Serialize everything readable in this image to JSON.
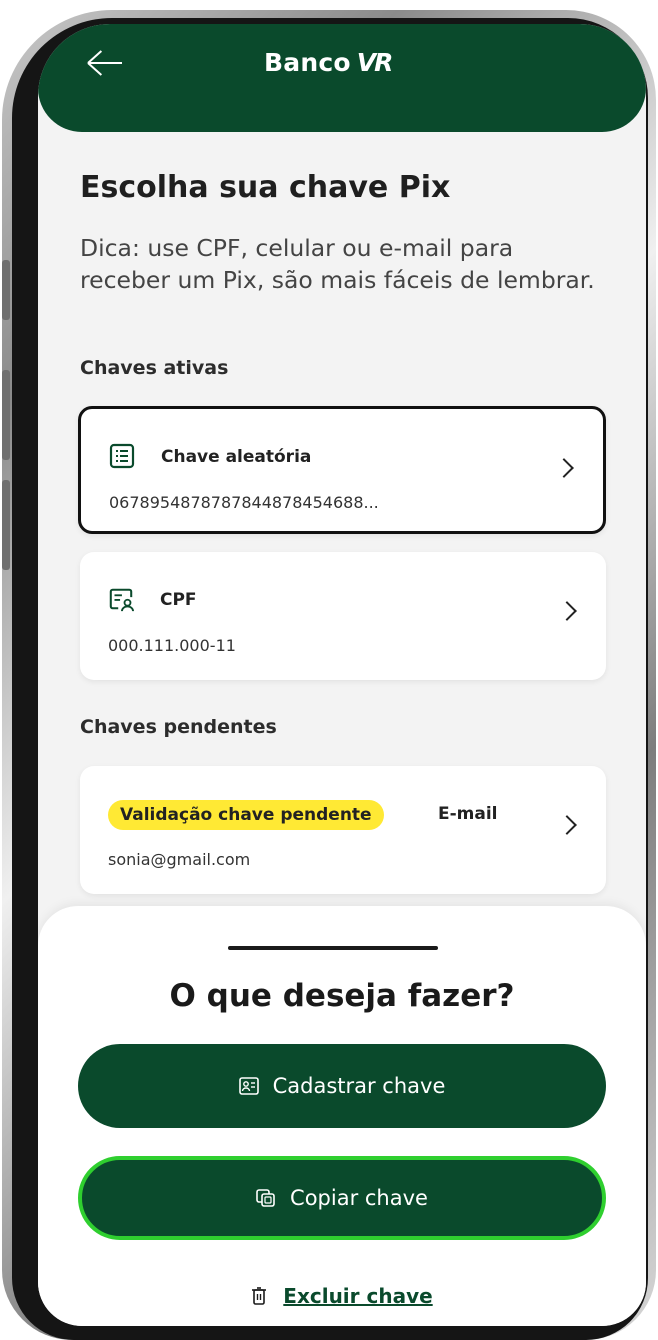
{
  "header": {
    "brand_name": "Banco",
    "brand_logo": "VR"
  },
  "page": {
    "title": "Escolha sua chave Pix",
    "tip": "Dica: use CPF, celular ou e-mail para receber um Pix, são mais fáceis de lembrar."
  },
  "active_keys": {
    "section_label": "Chaves ativas",
    "items": [
      {
        "title": "Chave aleatória",
        "value": "0678954878787844878454688...",
        "icon": "random-key-icon",
        "selected": true
      },
      {
        "title": "CPF",
        "value": "000.111.000-11",
        "icon": "cpf-id-icon",
        "selected": false
      }
    ]
  },
  "pending_keys": {
    "section_label": "Chaves pendentes",
    "items": [
      {
        "badge": "Validação chave pendente",
        "type": "E-mail",
        "value": "sonia@gmail.com"
      }
    ]
  },
  "sheet": {
    "title": "O que deseja fazer?",
    "register_label": "Cadastrar chave",
    "copy_label": "Copiar chave",
    "delete_label": "Excluir chave"
  },
  "colors": {
    "brand_green": "#0a4a2c",
    "highlight_green": "#2fcf2f",
    "badge_yellow": "#ffe934"
  }
}
